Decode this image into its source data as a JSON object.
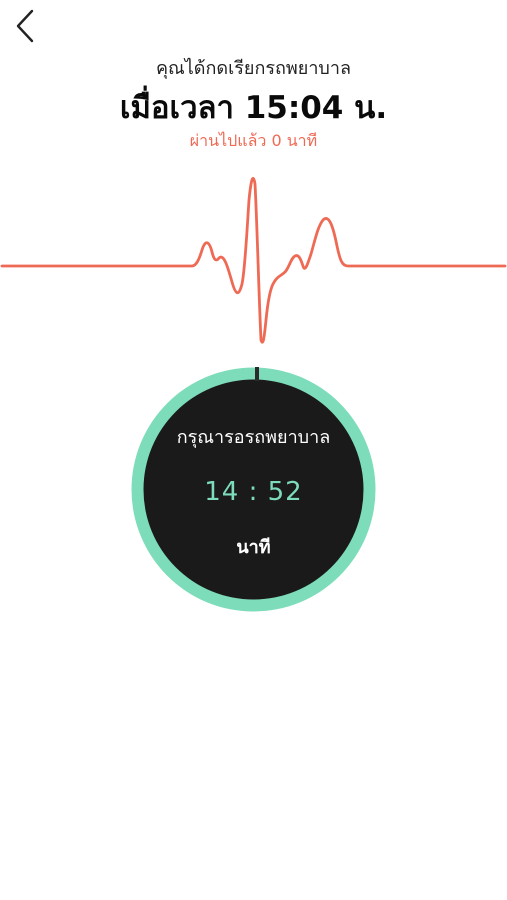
{
  "nav": {
    "back_icon": "chevron-left-icon"
  },
  "header": {
    "subtitle": "คุณได้กดเรียกรถพยาบาล",
    "call_time": "เมื่อเวลา 15:04 น.",
    "elapsed": "ผ่านไปแล้ว 0 นาที"
  },
  "timer": {
    "label": "กรุณารอรถพยาบาล",
    "value": "14 : 52",
    "unit": "นาที"
  },
  "colors": {
    "accent": "#ef6a55",
    "ring": "#7ddcb9",
    "timer_bg": "#1a1a1a",
    "background": "#ffffff"
  }
}
